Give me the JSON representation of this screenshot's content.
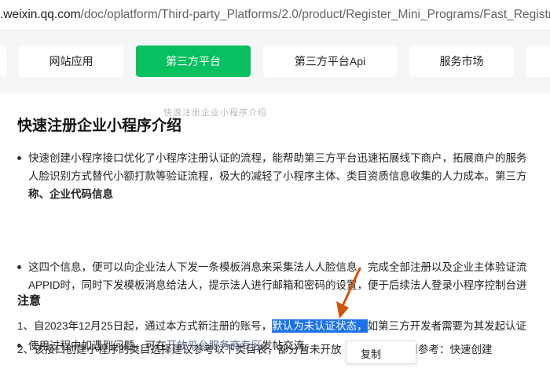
{
  "browser": {
    "url_host": ".weixin.qq.com",
    "url_path": "/doc/oplatform/Third-party_Platforms/2.0/product/Register_Mini_Programs/Fast_Registratio"
  },
  "nav": {
    "tabs": [
      {
        "label": ""
      },
      {
        "label": "网站应用"
      },
      {
        "label": "第三方平台"
      },
      {
        "label": "第三方平台Api"
      },
      {
        "label": "服务市场"
      },
      {
        "label": ""
      }
    ],
    "ghost_text": "快速注册企业小程序介绍"
  },
  "colors": {
    "accent": "#07c160",
    "link": "#576b95",
    "highlight": "#1a73e8",
    "arrow": "#d35400"
  },
  "article": {
    "title": "快速注册企业小程序介绍",
    "bullets": [
      {
        "lines": [
          "快速创建小程序接口优化了小程序注册认证的流程，能帮助第三方平台迅速拓展线下商户，拓展商户的服务",
          "人脸识别方式替代小额打款等验证流程，极大的减轻了小程序主体、类目资质信息收集的人力成本。第三方",
          "称、企业代码信息"
        ]
      },
      {
        "lines": [
          "这四个信息，便可以向企业法人下发一条模板消息来采集法人人脸信息，完成全部注册以及企业主体验证流",
          "APPID时，同时下发模板消息给法人，提示法人进行邮箱和密码的设置，便于后续法人登录小程序控制台进"
        ]
      },
      {
        "pre": "使用过程中如遇到问题，可在",
        "link": "开放平台服务商专区",
        "post": "发帖交流。"
      }
    ],
    "notice_heading": "注意",
    "notes": [
      {
        "pre": "1、自2023年12月25日起，通过本方式新注册的账号，",
        "highlight": "默认为未认证状态，",
        "post": "如第三方开发者需要为其发起认证"
      },
      {
        "pre": "2、该接口创建小程序的类目选择建议参考以下类目表，部分暂未开放",
        "post": "回，详情请参考：快速创建"
      }
    ]
  },
  "context_menu": {
    "copy_label": "复制"
  }
}
